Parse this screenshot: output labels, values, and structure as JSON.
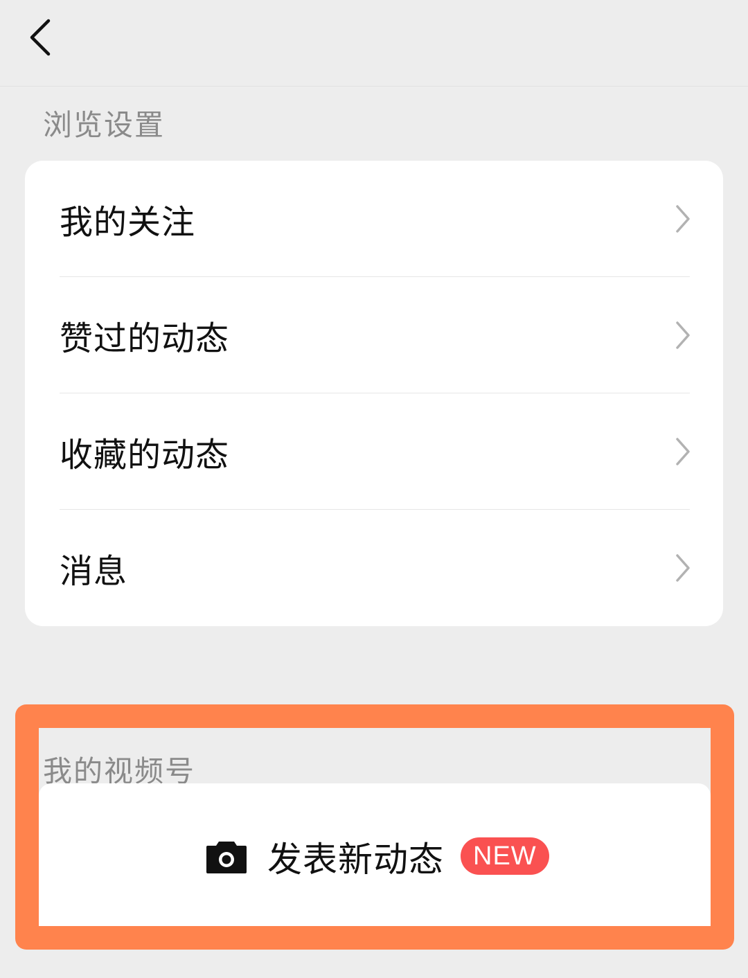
{
  "header": {
    "back_icon": "chevron-left-icon"
  },
  "browse_section": {
    "title": "浏览设置",
    "items": [
      {
        "label": "我的关注",
        "icon": "chevron-right-icon"
      },
      {
        "label": "赞过的动态",
        "icon": "chevron-right-icon"
      },
      {
        "label": "收藏的动态",
        "icon": "chevron-right-icon"
      },
      {
        "label": "消息",
        "icon": "chevron-right-icon"
      }
    ]
  },
  "channels_section": {
    "title": "我的视频号",
    "post_button": {
      "icon": "camera-icon",
      "label": "发表新动态",
      "badge": "NEW"
    }
  },
  "colors": {
    "background": "#ededed",
    "card": "#ffffff",
    "highlight": "#ff834d",
    "badge": "#fa5151",
    "section_title": "#8a8a8a"
  }
}
